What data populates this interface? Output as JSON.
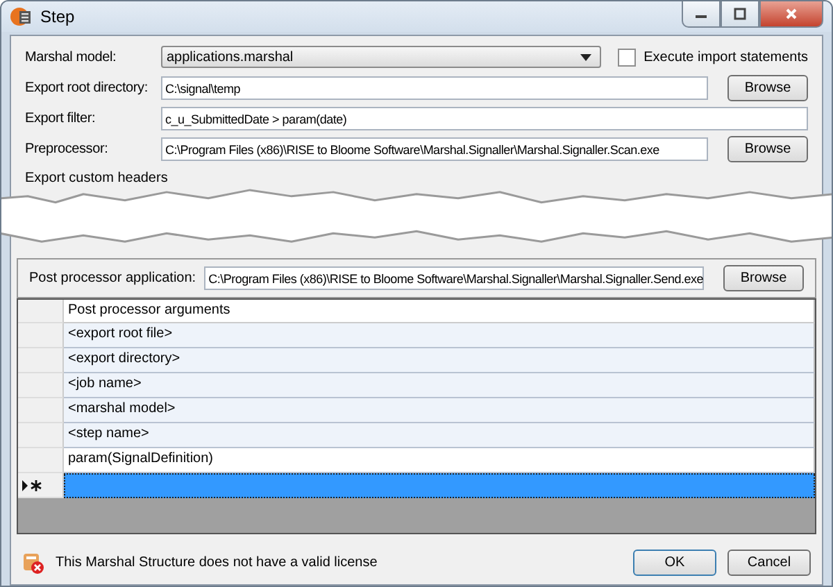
{
  "window": {
    "title": "Step"
  },
  "fields": [
    {
      "kind": "combo",
      "label": "Marshal model:",
      "value": "applications.marshal"
    },
    {
      "kind": "browse",
      "label": "Export root directory:",
      "value": "C:\\signal\\temp",
      "button": "Browse"
    },
    {
      "kind": "text",
      "label": "Export filter:",
      "value": "c_u_SubmittedDate > param(date)"
    },
    {
      "kind": "browse",
      "label": "Preprocessor:",
      "value": "C:\\Program Files (x86)\\RISE to Bloome Software\\Marshal.Signaller\\Marshal.Signaller.Scan.exe",
      "button": "Browse"
    }
  ],
  "execute_import": {
    "label": "Execute import statements",
    "checked": false
  },
  "custom_headers": {
    "label": "Export custom headers"
  },
  "post_processor": {
    "label": "Post processor application:",
    "value": "C:\\Program Files (x86)\\RISE to Bloome Software\\Marshal.Signaller\\Marshal.Signaller.Send.exe",
    "button": "Browse",
    "column": "Post processor arguments",
    "rows": [
      {
        "text": "<export root file>",
        "readonly": true,
        "selected": false
      },
      {
        "text": "<export directory>",
        "readonly": true,
        "selected": false
      },
      {
        "text": "<job name>",
        "readonly": true,
        "selected": false
      },
      {
        "text": "<marshal model>",
        "readonly": true,
        "selected": false
      },
      {
        "text": "<step name>",
        "readonly": true,
        "selected": false
      },
      {
        "text": "param(SignalDefinition)",
        "readonly": false,
        "selected": false
      },
      {
        "text": "",
        "readonly": false,
        "selected": true,
        "new_row": true
      }
    ]
  },
  "status": {
    "message": "This Marshal Structure does not have a valid license"
  },
  "buttons": [
    "OK",
    "Cancel"
  ]
}
